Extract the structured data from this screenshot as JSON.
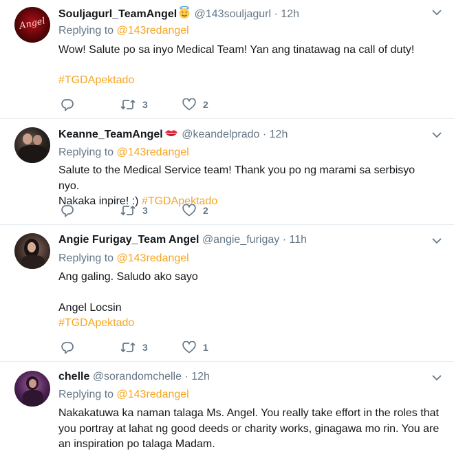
{
  "tweets": [
    {
      "name": "Souljagurl_TeamAngel",
      "emoji": "smiling-face-with-halo",
      "handle": "@143souljagurl",
      "dot": "·",
      "time": "12h",
      "replying_prefix": "Replying to",
      "replying_to": "@143redangel",
      "line1": "Wow! Salute po sa inyo Medical Team! Yan ang tinatawag na call of duty!",
      "hashtag": "#TGDApektado",
      "retweets": "3",
      "likes": "2",
      "avatar_text": "Angel"
    },
    {
      "name": "Keanne_TeamAngel",
      "emoji": "kiss-mark",
      "handle": "@keandelprado",
      "dot": "·",
      "time": "12h",
      "replying_prefix": "Replying to",
      "replying_to": "@143redangel",
      "line1": "Salute to the Medical Service team! Thank you po ng marami sa serbisyo nyo.",
      "line2": "Nakaka inpire! :) ",
      "hashtag": "#TGDApektado",
      "retweets": "3",
      "likes": "2"
    },
    {
      "name": "Angie Furigay_Team Angel",
      "handle": "@angie_furigay",
      "dot": "·",
      "time": "11h",
      "replying_prefix": "Replying to",
      "replying_to": "@143redangel",
      "line1": "Ang galing. Saludo ako sayo",
      "line2": "Angel Locsin",
      "hashtag": "#TGDApektado",
      "retweets": "3",
      "likes": "1"
    },
    {
      "name": "chelle",
      "handle": "@sorandomchelle",
      "dot": "·",
      "time": "12h",
      "replying_prefix": "Replying to",
      "replying_to": "@143redangel",
      "line1": "Nakakatuwa ka naman talaga Ms. Angel. You really take effort in the roles that",
      "line2": "you portray at lahat ng good deeds or charity works, ginagawa mo rin. You are",
      "line3": "an inspiration po talaga Madam."
    }
  ],
  "colors": {
    "accent": "#f5a623",
    "muted": "#657786",
    "text": "#14171a",
    "divider": "#e6ecf0"
  },
  "icons": [
    "reply-icon",
    "retweet-icon",
    "like-icon",
    "chevron-down-icon"
  ]
}
